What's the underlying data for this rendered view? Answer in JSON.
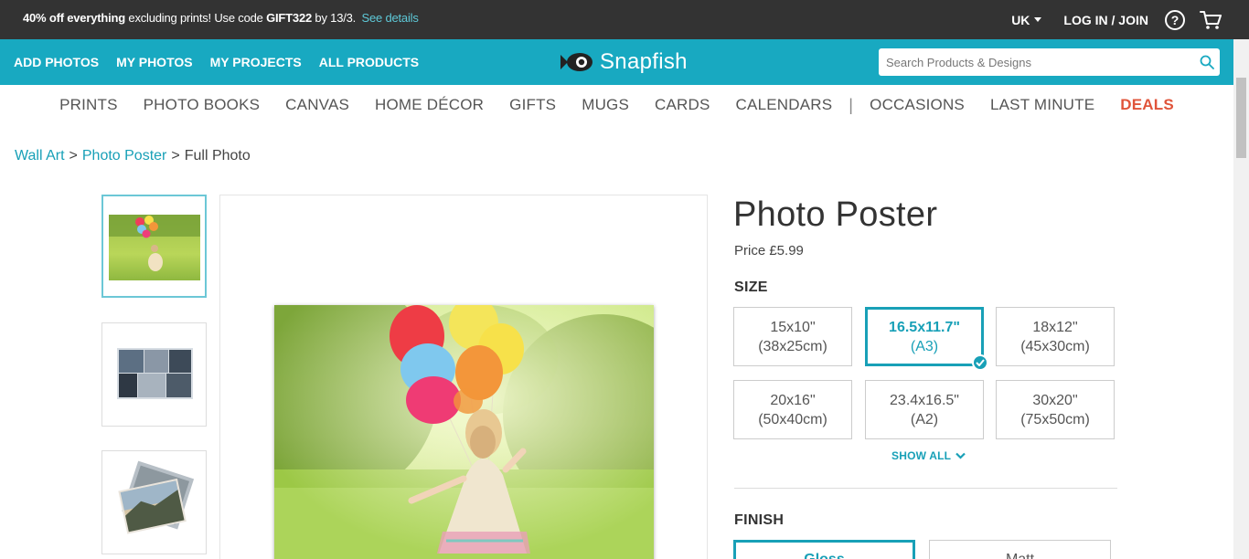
{
  "promo": {
    "bold_1": "40% off everything",
    "text_1": " excluding prints! Use code ",
    "code": "GIFT322",
    "text_2": " by 13/3.",
    "link": "See details"
  },
  "top_right": {
    "region": "UK",
    "login": "LOG IN / JOIN",
    "help_glyph": "?"
  },
  "teal_nav": [
    "ADD PHOTOS",
    "MY PHOTOS",
    "MY PROJECTS",
    "ALL PRODUCTS"
  ],
  "logo": "Snapfish",
  "search": {
    "placeholder": "Search Products & Designs"
  },
  "categories": [
    "PRINTS",
    "PHOTO BOOKS",
    "CANVAS",
    "HOME DÉCOR",
    "GIFTS",
    "MUGS",
    "CARDS",
    "CALENDARS"
  ],
  "categories_after": [
    "OCCASIONS",
    "LAST MINUTE"
  ],
  "deals_label": "DEALS",
  "breadcrumb": {
    "item1": "Wall Art",
    "item2": "Photo Poster",
    "current": "Full Photo",
    "sep": ">"
  },
  "product": {
    "title": "Photo Poster",
    "price": "Price £5.99",
    "size_label": "SIZE",
    "sizes": [
      {
        "l1": "15x10\"",
        "l2": "(38x25cm)"
      },
      {
        "l1": "16.5x11.7\"",
        "l2": "(A3)",
        "selected": true
      },
      {
        "l1": "18x12\"",
        "l2": "(45x30cm)"
      },
      {
        "l1": "20x16\"",
        "l2": "(50x40cm)"
      },
      {
        "l1": "23.4x16.5\"",
        "l2": "(A2)"
      },
      {
        "l1": "30x20\"",
        "l2": "(75x50cm)"
      }
    ],
    "show_all": "SHOW ALL",
    "finish_label": "FINISH",
    "finishes": [
      "Gloss",
      "Matt"
    ]
  },
  "colors": {
    "teal": "#18a9c1",
    "dark": "#333333",
    "accent": "#18a0b7",
    "deals": "#e0543a"
  }
}
